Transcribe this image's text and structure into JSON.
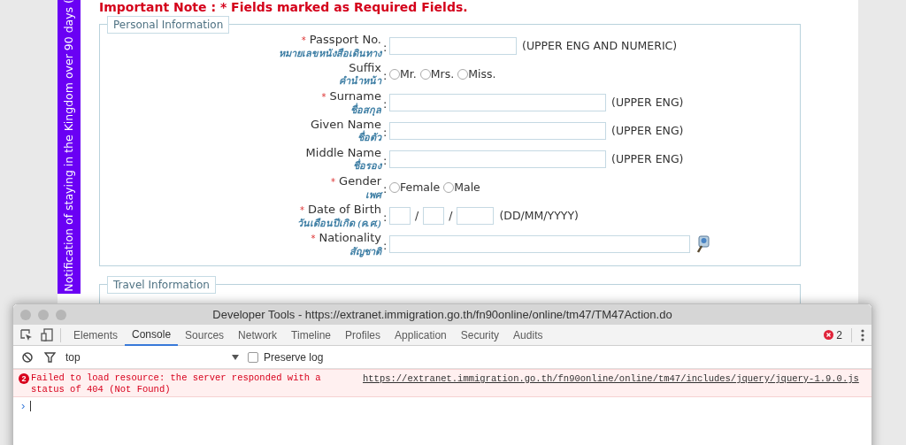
{
  "page": {
    "side_tab": "Notification of staying in the Kingdom over 90 days (",
    "important_note": "Important Note : * Fields marked as Required Fields.",
    "sections": [
      {
        "legend": "Personal Information",
        "fields": [
          {
            "kind": "short-text",
            "required_mark": "*",
            "label": "Passport No.",
            "label_th": "หมายเลขหนังสือเดินทาง",
            "separator": ":",
            "hint": "(UPPER ENG AND NUMERIC)"
          },
          {
            "kind": "radio",
            "label": "Suffix",
            "label_th": "คำนำหน้า",
            "separator": ":",
            "options": [
              {
                "label": "Mr.",
                "selected": false
              },
              {
                "label": "Mrs.",
                "selected": false
              },
              {
                "label": "Miss.",
                "selected": false
              }
            ]
          },
          {
            "kind": "text",
            "required_mark": "*",
            "label": "Surname",
            "label_th": "ชื่อสกุล",
            "separator": ":",
            "hint": "(UPPER ENG)"
          },
          {
            "kind": "text",
            "label": "Given Name",
            "label_th": "ชื่อตัว",
            "separator": ":",
            "hint": "(UPPER ENG)"
          },
          {
            "kind": "text",
            "label": "Middle Name",
            "label_th": "ชื่อรอง",
            "separator": ":",
            "hint": "(UPPER ENG)"
          },
          {
            "kind": "radio",
            "required_mark": "*",
            "label": "Gender",
            "label_th": "เพศ",
            "separator": ":",
            "options": [
              {
                "label": "Female",
                "selected": false
              },
              {
                "label": "Male",
                "selected": false
              }
            ]
          },
          {
            "kind": "date",
            "required_mark": "*",
            "label": "Date of Birth",
            "label_th": "วันเดือนปีเกิด (ค.ศ.)",
            "separator": ":",
            "slashes": [
              "/",
              "/"
            ],
            "hint": "(DD/MM/YYYY)"
          },
          {
            "kind": "lookup",
            "required_mark": "*",
            "label": "Nationality",
            "label_th": "สัญชาติ",
            "separator": ":"
          }
        ]
      },
      {
        "legend": "Travel Information"
      }
    ]
  },
  "devtools": {
    "title": "Developer Tools - https://extranet.immigration.go.th/fn90online/online/tm47/TM47Action.do",
    "tabs": [
      {
        "label": "Elements",
        "selected": false
      },
      {
        "label": "Console",
        "selected": true
      },
      {
        "label": "Sources",
        "selected": false
      },
      {
        "label": "Network",
        "selected": false
      },
      {
        "label": "Timeline",
        "selected": false
      },
      {
        "label": "Profiles",
        "selected": false
      },
      {
        "label": "Application",
        "selected": false
      },
      {
        "label": "Security",
        "selected": false
      },
      {
        "label": "Audits",
        "selected": false
      }
    ],
    "error_count": "2",
    "context": "top",
    "preserve_log": {
      "label": "Preserve log",
      "checked": false
    },
    "messages": [
      {
        "count": "2",
        "text": "Failed to load resource: the server responded with a status of 404 (Not Found)",
        "url": "https://extranet.immigration.go.th/fn90online/online/tm47/includes/jquery/jquery-1.9.0.js"
      }
    ],
    "prompt": "›"
  }
}
